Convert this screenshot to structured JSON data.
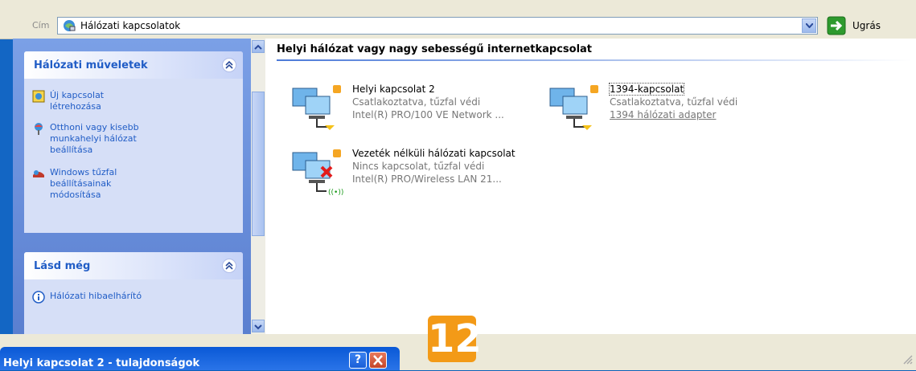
{
  "address_bar": {
    "label": "Cím",
    "value": "Hálózati kapcsolatok",
    "go_label": "Ugrás"
  },
  "sidebar": {
    "network_tasks": {
      "title": "Hálózati műveletek",
      "items": [
        {
          "label": "Új kapcsolat\nlétrehozása",
          "l1": "Új kapcsolat",
          "l2": "létrehozása"
        },
        {
          "l1": "Otthoni vagy kisebb",
          "l2": "munkahelyi hálózat",
          "l3": "beállítása"
        },
        {
          "l1": "Windows tűzfal",
          "l2": "beállításainak",
          "l3": "módosítása"
        }
      ]
    },
    "see_also": {
      "title": "Lásd még",
      "items": [
        {
          "label": "Hálózati hibaelhárító"
        }
      ]
    }
  },
  "content": {
    "group_title": "Helyi hálózat vagy nagy sebességű internetkapcsolat",
    "connections": [
      {
        "name": "Helyi kapcsolat 2",
        "status": "Csatlakoztatva, tűzfal védi",
        "device": "Intel(R) PRO/100 VE Network ..."
      },
      {
        "name": "1394-kapcsolat",
        "status": "Csatlakoztatva, tűzfal védi",
        "device": "1394 hálózati adapter"
      },
      {
        "name": "Vezeték nélküli hálózati kapcsolat",
        "status": "Nincs kapcsolat, tűzfal védi",
        "device": "Intel(R) PRO/Wireless LAN 21..."
      }
    ]
  },
  "dialog": {
    "title": "Helyi kapcsolat 2 - tulajdonságok",
    "help_label": "?"
  },
  "step_badge": "12",
  "colors": {
    "accent": "#215dc6",
    "badge": "#f39a17",
    "titlebar": "#0a59d6"
  }
}
